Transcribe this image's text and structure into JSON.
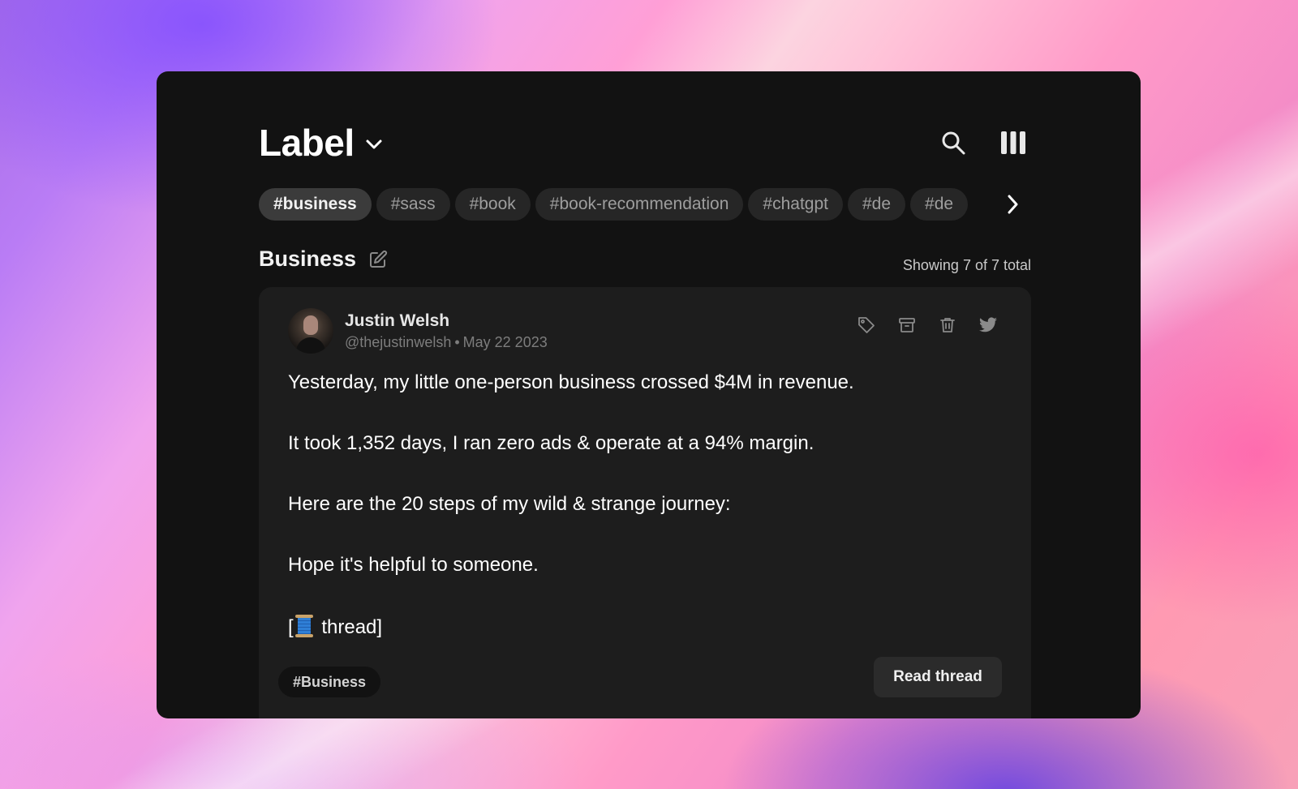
{
  "header": {
    "title": "Label",
    "icons": {
      "dropdown": "chevron-down-icon",
      "search": "search-icon",
      "layout": "columns-icon"
    }
  },
  "tags": {
    "items": [
      {
        "label": "#business",
        "active": true
      },
      {
        "label": "#sass",
        "active": false
      },
      {
        "label": "#book",
        "active": false
      },
      {
        "label": "#book-recommendation",
        "active": false
      },
      {
        "label": "#chatgpt",
        "active": false
      },
      {
        "label": "#de",
        "active": false
      },
      {
        "label": "#de",
        "active": false
      }
    ],
    "next_icon": "chevron-right-icon"
  },
  "section": {
    "title": "Business",
    "edit_icon": "edit-icon",
    "count_text": "Showing 7 of 7 total"
  },
  "post": {
    "author_name": "Justin Welsh",
    "author_handle": "@thejustinwelsh",
    "separator": "•",
    "date": "May 22 2023",
    "actions": [
      "tag-icon",
      "archive-icon",
      "trash-icon",
      "twitter-icon"
    ],
    "paragraphs": [
      "Yesterday, my little one-person business crossed $4M in revenue.",
      "It took 1,352 days, I ran zero ads & operate at a 94% margin.",
      "Here are the 20 steps of my wild & strange journey:",
      "Hope it's helpful to someone."
    ],
    "thread_prefix": "[",
    "thread_emoji": "🧵",
    "thread_suffix": " thread]",
    "tag": "#Business",
    "read_button": "Read thread"
  },
  "colors": {
    "window_bg": "#121212",
    "card_bg": "#1d1d1d",
    "tag_bg": "#262626",
    "tag_active_bg": "#3b3b3b",
    "text_primary": "#ffffff",
    "text_muted": "#7d7d7d"
  }
}
